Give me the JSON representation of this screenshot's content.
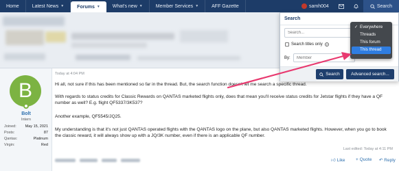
{
  "nav": {
    "tabs": [
      {
        "label": "Home"
      },
      {
        "label": "Latest News"
      },
      {
        "label": "Forums"
      },
      {
        "label": "What's new"
      },
      {
        "label": "Member Services"
      },
      {
        "label": "AFF Gazette"
      }
    ],
    "user": "samh004",
    "search_label": "Search"
  },
  "search_popup": {
    "title": "Search",
    "placeholder": "Search...",
    "titles_only_label": "Search titles only",
    "by_label": "By:",
    "by_placeholder": "Member",
    "search_button": "Search",
    "advanced_button": "Advanced search..."
  },
  "dropdown": {
    "options": [
      "Everywhere",
      "Threads",
      "This forum",
      "This thread"
    ],
    "selected": "Everywhere",
    "highlighted": "This thread"
  },
  "post": {
    "avatar_letter": "B",
    "username": "Bolt",
    "user_title": "Intern",
    "stats": [
      {
        "label": "Joined:",
        "value": "May 15, 2021"
      },
      {
        "label": "Posts:",
        "value": "87"
      },
      {
        "label": "Qantas:",
        "value": "Platinum"
      },
      {
        "label": "Virgin:",
        "value": "Red"
      }
    ],
    "date": "Today at 4:04 PM",
    "paragraphs": [
      "Hi all, not sure if this has been mentioned so far in the thread. But, the search function doesn't let me search a specific thread.",
      "With regards to status credits for Classic Rewards on QANTAS marketed flights only, does that mean you'll receive status credits for Jetstar flights if they have a QF number as well? E.g. flight QF5337/3K537?",
      "Another example, QF5545/JQ25.",
      "My understanding is that it's not just QANTAS operated flights with the QANTAS logo on the plane, but also QANTAS marketed flights. However, when you go to book the classic reward, it will always show up with a JQ/3K number, even if there is an applicable QF number."
    ],
    "last_edited": "Last edited: Today at 4:11 PM",
    "actions": {
      "like": "Like",
      "quote": "+ Quote",
      "reply": "Reply"
    }
  },
  "colors": {
    "nav_bg": "#1d3c68",
    "accent": "#2f7de1",
    "avatar_bg": "#7cb342",
    "arrow": "#e8396f"
  }
}
